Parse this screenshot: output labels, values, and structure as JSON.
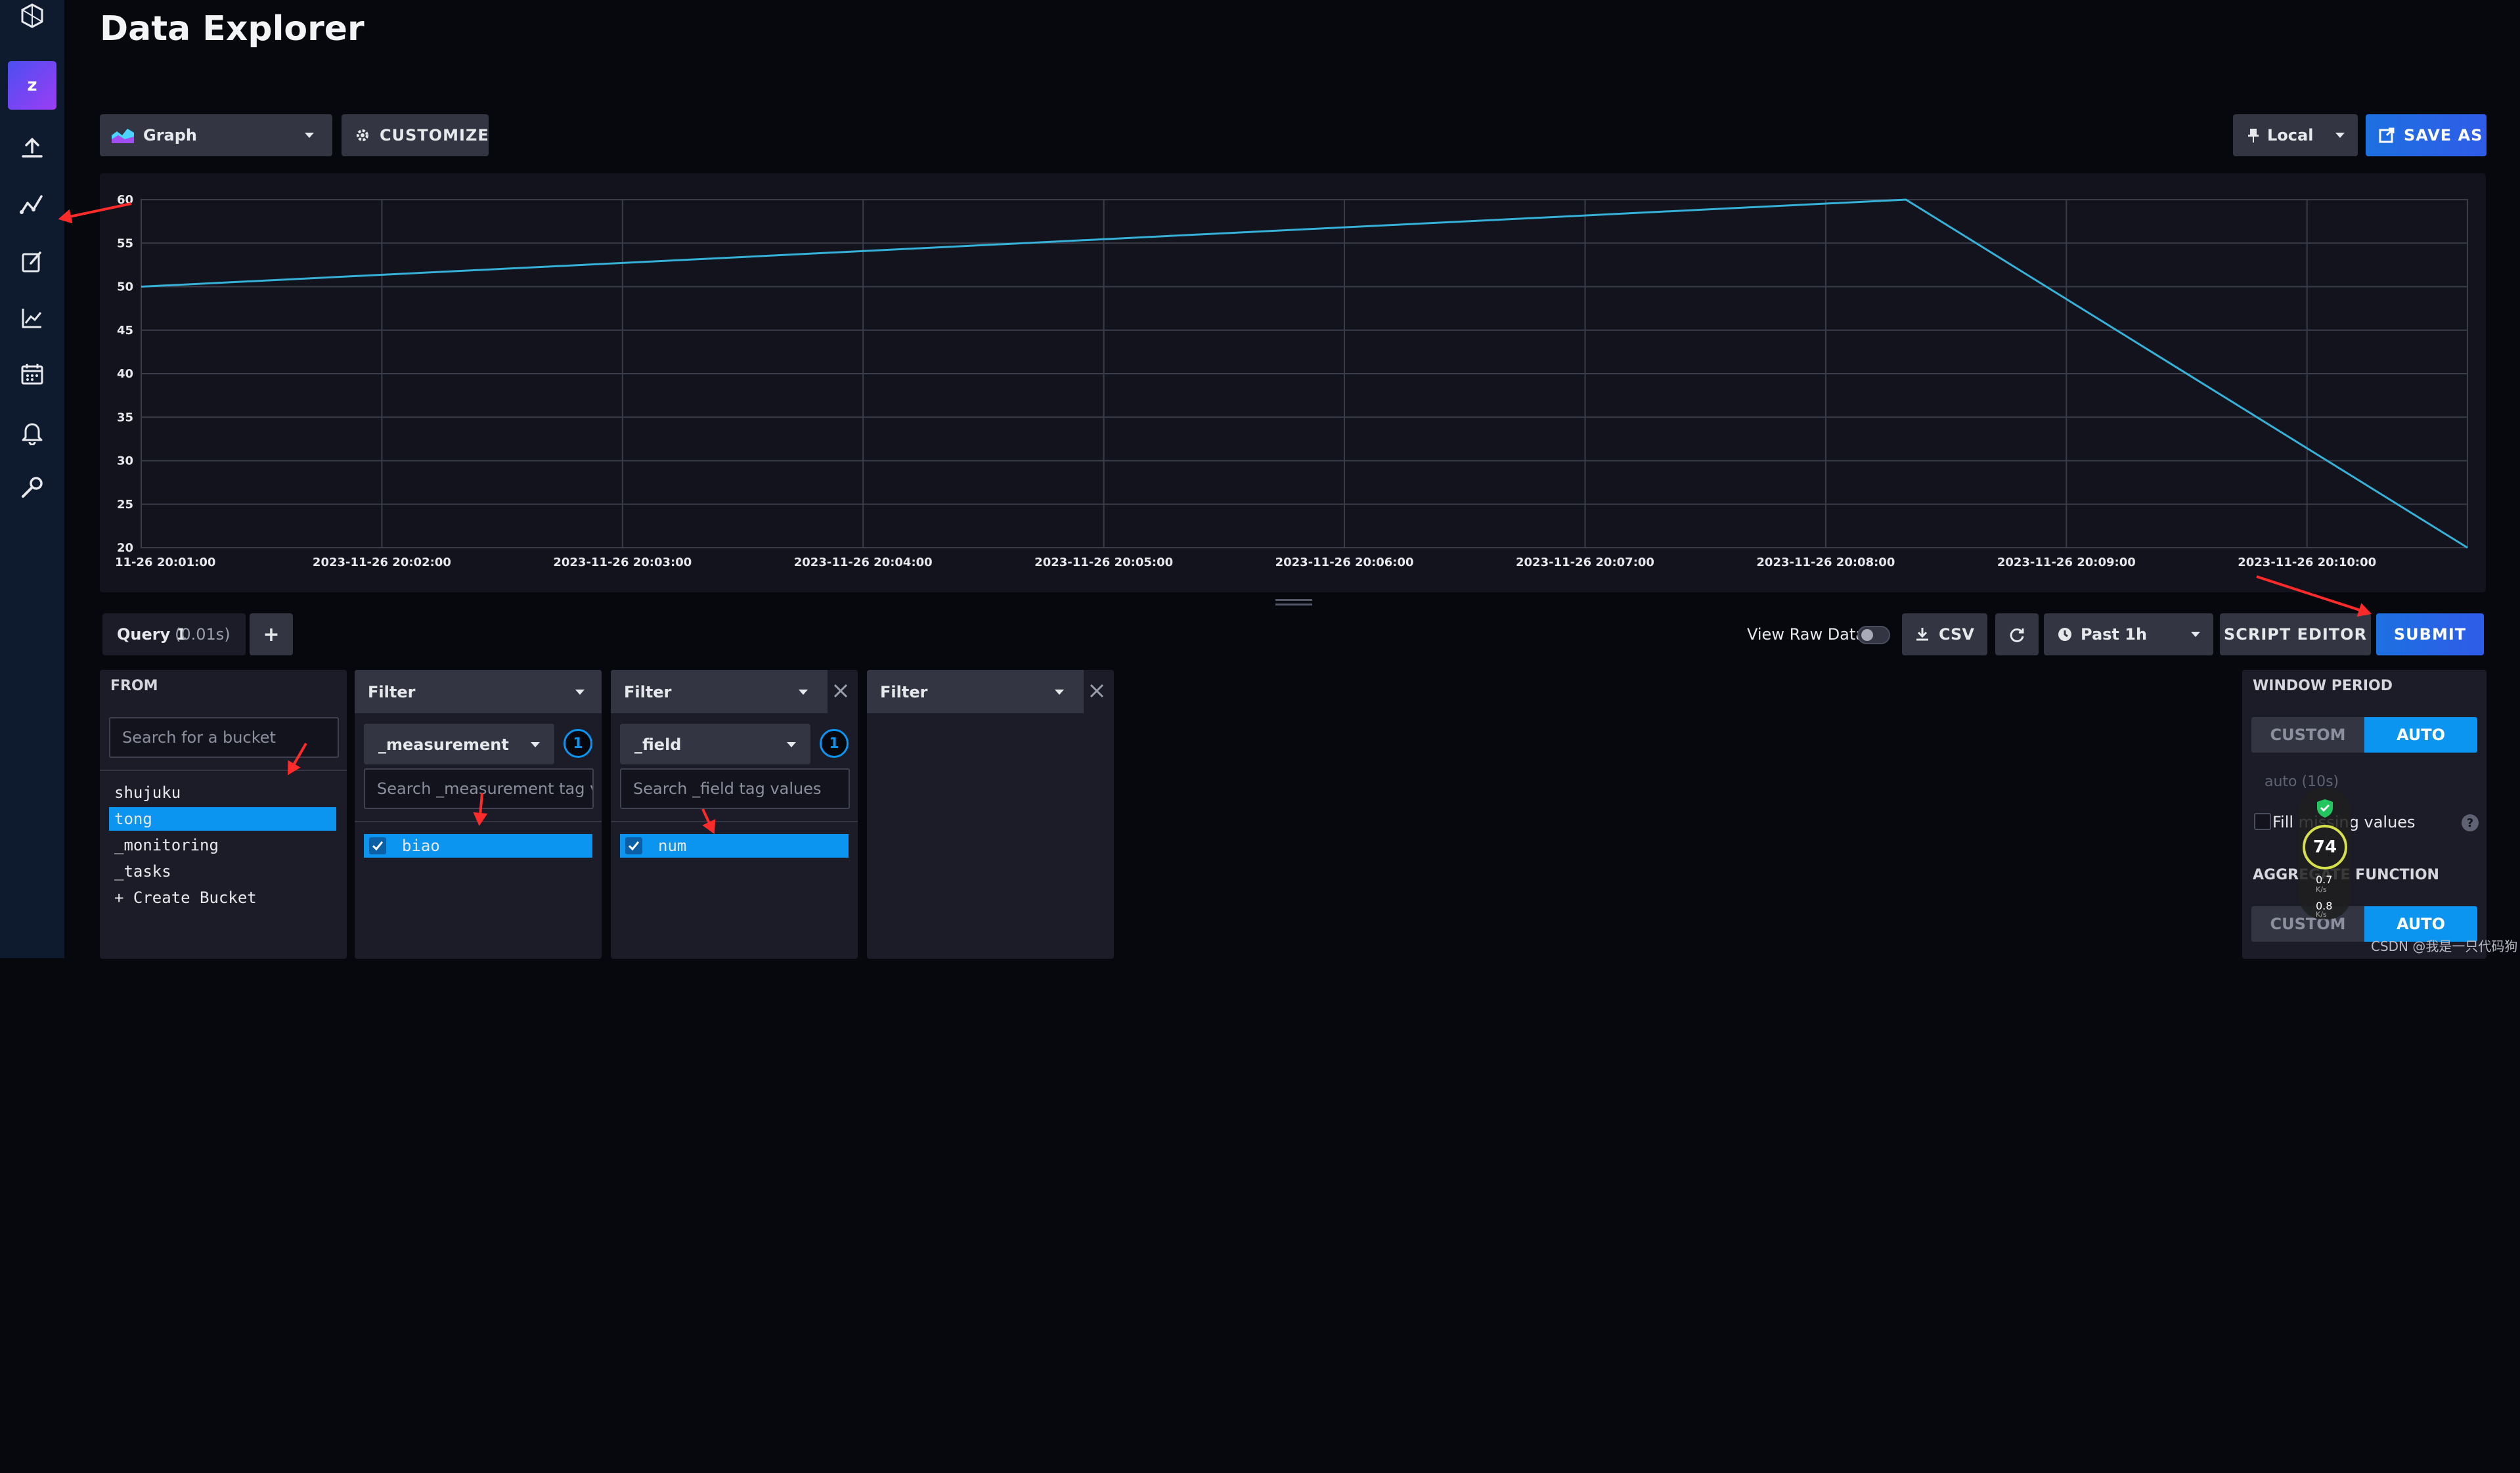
{
  "header": {
    "title": "Data Explorer"
  },
  "sidebar": {
    "org_initial": "z",
    "icons": [
      "logo-icon",
      "upload-icon",
      "data-explorer-icon",
      "notebook-icon",
      "dashboard-icon",
      "tasks-icon",
      "alerts-icon",
      "settings-icon"
    ]
  },
  "toolbar": {
    "graph_type": "Graph",
    "customize_label": "CUSTOMIZE",
    "timezone_label": "Local",
    "save_as_label": "SAVE AS"
  },
  "chart_data": {
    "type": "line",
    "x": [
      "2023-11-26 20:01:00",
      "2023-11-26 20:08:20",
      "2023-11-26 20:10:40"
    ],
    "y": [
      50,
      60,
      20
    ],
    "ylim": [
      20,
      60
    ],
    "y_ticks": [
      20,
      25,
      30,
      35,
      40,
      45,
      50,
      55,
      60
    ],
    "x_tick_labels": [
      "11-26 20:01:00",
      "2023-11-26 20:02:00",
      "2023-11-26 20:03:00",
      "2023-11-26 20:04:00",
      "2023-11-26 20:05:00",
      "2023-11-26 20:06:00",
      "2023-11-26 20:07:00",
      "2023-11-26 20:08:00",
      "2023-11-26 20:09:00",
      "2023-11-26 20:10:00"
    ],
    "grid": true,
    "line_color": "#36b1d8"
  },
  "query_bar": {
    "tab_label": "Query 1",
    "tab_time": "(0.01s)",
    "add_label": "+",
    "view_raw_label": "View Raw Data",
    "csv_label": "CSV",
    "time_range": "Past 1h",
    "script_editor_label": "SCRIPT EDITOR",
    "submit_label": "SUBMIT"
  },
  "from_card": {
    "title": "FROM",
    "search_placeholder": "Search for a bucket",
    "buckets": [
      "shujuku",
      "tong",
      "_monitoring",
      "_tasks",
      "+ Create Bucket"
    ],
    "selected": "tong"
  },
  "filter1": {
    "title": "Filter",
    "key": "_measurement",
    "count": "1",
    "search_placeholder": "Search _measurement tag va",
    "values": [
      "biao"
    ]
  },
  "filter2": {
    "title": "Filter",
    "key": "_field",
    "count": "1",
    "search_placeholder": "Search _field tag values",
    "values": [
      "num"
    ]
  },
  "filter3": {
    "title": "Filter"
  },
  "window_panel": {
    "window_title": "WINDOW PERIOD",
    "custom_label": "CUSTOM",
    "auto_label": "AUTO",
    "auto_value": "auto (10s)",
    "fill_label": "Fill missing values",
    "help": "?",
    "aggregate_title": "AGGREGATE FUNCTION",
    "custom_label2": "CUSTOM",
    "auto_label2": "AUTO"
  },
  "overlay": {
    "percent": "74",
    "up": "0.7",
    "down": "0.8",
    "unit": "K/s"
  },
  "watermark": "CSDN @我是一只代码狗"
}
